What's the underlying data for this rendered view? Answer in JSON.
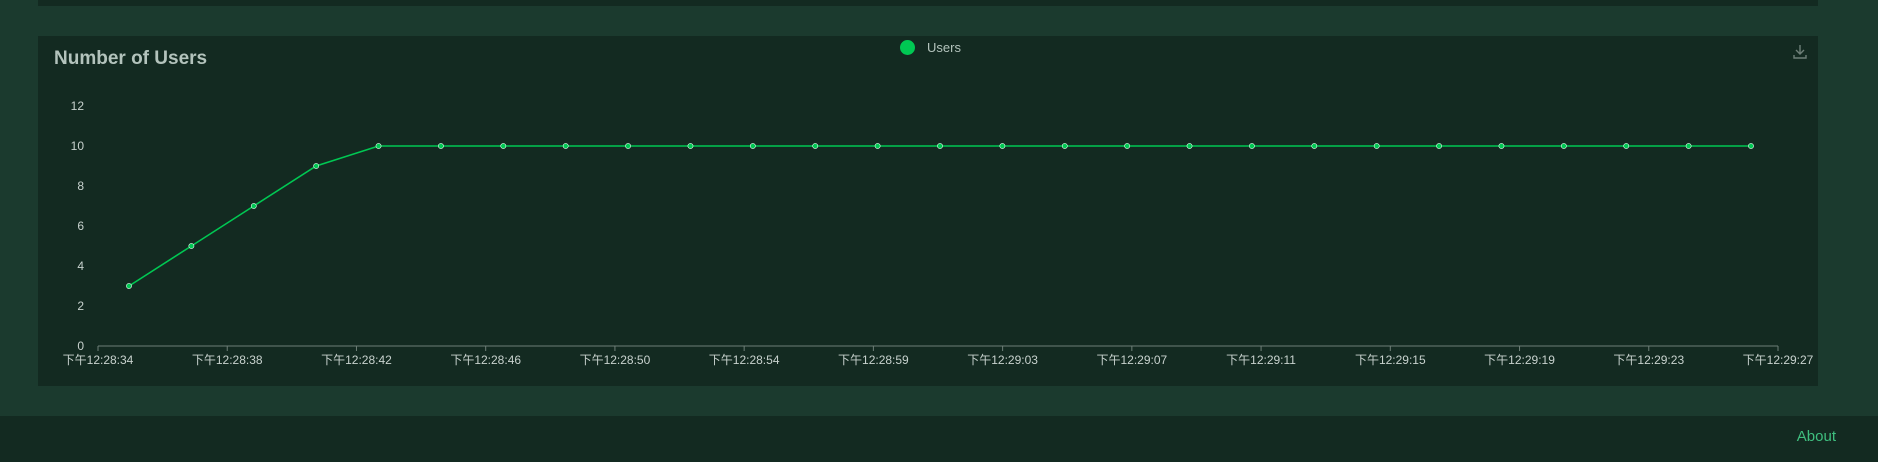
{
  "chart": {
    "title": "Number of Users",
    "legend_label": "Users"
  },
  "footer": {
    "about_label": "About"
  },
  "colors": {
    "line": "#00c853",
    "axis": "#6e7f78",
    "tick_text": "#c8d2ce",
    "panel": "#132a21",
    "background": "#1b3a2e"
  },
  "icons": {
    "download": "download-icon"
  },
  "chart_data": {
    "type": "line",
    "title": "Number of Users",
    "xlabel": "",
    "ylabel": "",
    "ylim": [
      0,
      12
    ],
    "yticks": [
      0,
      2,
      4,
      6,
      8,
      10,
      12
    ],
    "grid": false,
    "legend_position": "top-center",
    "x_tick_labels": [
      "下午12:28:34",
      "下午12:28:38",
      "下午12:28:42",
      "下午12:28:46",
      "下午12:28:50",
      "下午12:28:54",
      "下午12:28:59",
      "下午12:29:03",
      "下午12:29:07",
      "下午12:29:11",
      "下午12:29:15",
      "下午12:29:19",
      "下午12:29:23",
      "下午12:29:27"
    ],
    "series": [
      {
        "name": "Users",
        "values": [
          3,
          5,
          7,
          9,
          10,
          10,
          10,
          10,
          10,
          10,
          10,
          10,
          10,
          10,
          10,
          10,
          10,
          10,
          10,
          10,
          10,
          10,
          10,
          10,
          10,
          10,
          10
        ]
      }
    ]
  }
}
